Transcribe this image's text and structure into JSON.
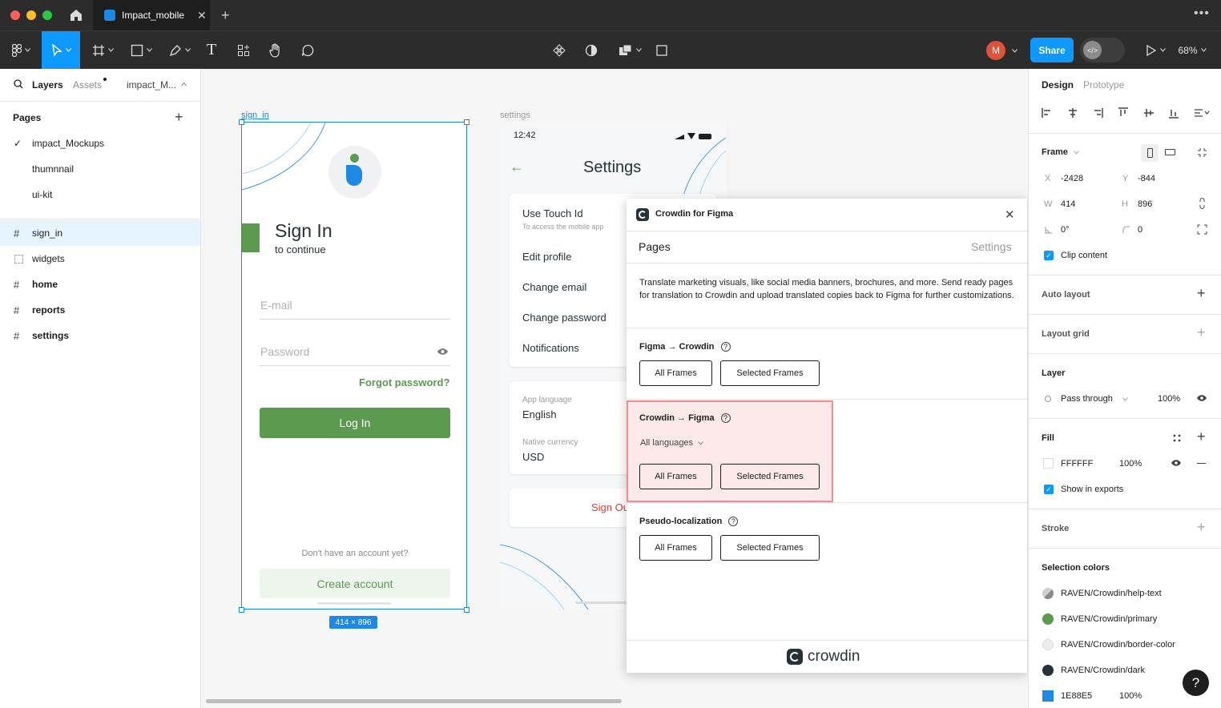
{
  "titlebar": {
    "file_tab": "Impact_mobile"
  },
  "toolbar": {
    "avatar_letter": "M",
    "share_label": "Share",
    "zoom_label": "68%"
  },
  "left_panel": {
    "layers_tab": "Layers",
    "assets_tab": "Assets",
    "file_dropdown": "impact_M...",
    "pages_heading": "Pages",
    "pages": [
      "impact_Mockups",
      "thumnnail",
      "ui-kit"
    ],
    "frames": [
      "sign_in",
      "widgets",
      "home",
      "reports",
      "settings"
    ]
  },
  "canvas": {
    "signin_frame_label": "sign_in",
    "settings_frame_label": "settings",
    "size_badge": "414 × 896",
    "signin": {
      "title": "Sign In",
      "subtitle": "to continue",
      "email_placeholder": "E-mail",
      "password_placeholder": "Password",
      "forgot": "Forgot password?",
      "login": "Log In",
      "no_account": "Don't have an account yet?",
      "create": "Create account"
    },
    "settings": {
      "time": "12:42",
      "title": "Settings",
      "touch_id": "Use Touch Id",
      "touch_id_sub": "To access the mobile app",
      "edit_profile": "Edit profile",
      "change_email": "Change email",
      "change_password": "Change password",
      "notifications": "Notifications",
      "app_language_label": "App language",
      "app_language": "English",
      "currency_label": "Native currency",
      "currency": "USD",
      "sign_out": "Sign Ou"
    }
  },
  "plugin": {
    "title": "Crowdin for Figma",
    "tab_pages": "Pages",
    "tab_settings": "Settings",
    "description": "Translate marketing visuals, like social media banners, brochures, and more. Send ready pages for translation to Crowdin and upload translated copies back to Figma for further customizations.",
    "sections": [
      {
        "title": "Figma → Crowdin",
        "all": "All Frames",
        "selected": "Selected Frames"
      },
      {
        "title": "Crowdin → Figma",
        "languages": "All languages",
        "all": "All Frames",
        "selected": "Selected Frames"
      },
      {
        "title": "Pseudo-localization",
        "all": "All Frames",
        "selected": "Selected Frames"
      }
    ],
    "footer_logo": "crowdin"
  },
  "right_panel": {
    "design_tab": "Design",
    "prototype_tab": "Prototype",
    "frame_label": "Frame",
    "x_label": "X",
    "x": "-2428",
    "y_label": "Y",
    "y": "-844",
    "w_label": "W",
    "w": "414",
    "h_label": "H",
    "h": "896",
    "rotation": "0°",
    "radius": "0",
    "clip_content": "Clip content",
    "auto_layout": "Auto layout",
    "layout_grid": "Layout grid",
    "layer": "Layer",
    "blend": "Pass through",
    "opacity": "100%",
    "fill": "Fill",
    "fill_hex": "FFFFFF",
    "fill_opacity": "100%",
    "show_exports": "Show in exports",
    "stroke": "Stroke",
    "selection_colors": "Selection colors",
    "colors": [
      {
        "name": "RAVEN/Crowdin/help-text",
        "color": "#8a8a8a"
      },
      {
        "name": "RAVEN/Crowdin/primary",
        "color": "#5b9a4f"
      },
      {
        "name": "RAVEN/Crowdin/border-color",
        "color": "#e4e4e4"
      },
      {
        "name": "RAVEN/Crowdin/dark",
        "color": "#263238"
      },
      {
        "name": "1E88E5",
        "color": "#1e88e5",
        "opacity": "100%"
      }
    ],
    "help": "?"
  },
  "colors": {
    "accent": "#0d99ff",
    "primary_green": "#5b9a4f",
    "highlight_red": "#f24822",
    "frame_blue": "#1e88e5"
  }
}
